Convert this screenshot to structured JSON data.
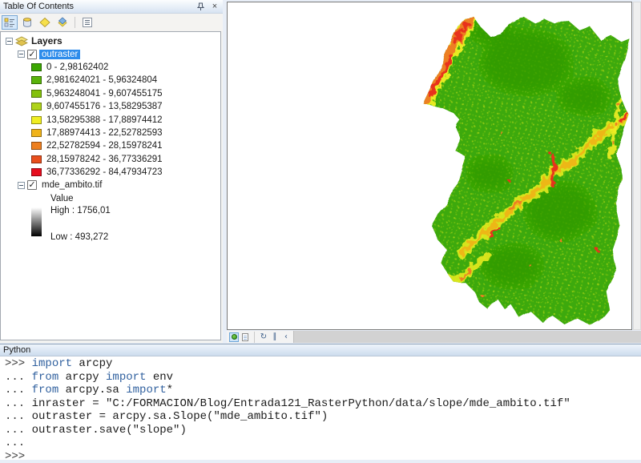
{
  "palette": {
    "selection-blue": "#2D8CEB",
    "keyword-blue": "#31619F",
    "map-green": "#3CA908",
    "map-green-dark": "#2E9902",
    "speckle-green": "#9ED313",
    "speckle-yellow": "#F0EE22",
    "ridge-orange": "#F0B31A",
    "ridge-orange-deep": "#ED7F20",
    "ridge-red": "#E8321C"
  },
  "icons": {
    "close": "×",
    "check": "✓",
    "refresh": "↻",
    "pause": "∥",
    "back": "‹"
  },
  "toc": {
    "title": "Table Of Contents",
    "toolbar": [
      {
        "name": "list-by-drawing-order",
        "selected": true
      },
      {
        "name": "list-by-source",
        "selected": false
      },
      {
        "name": "list-by-visibility",
        "selected": false
      },
      {
        "name": "list-by-selection",
        "selected": false
      },
      {
        "name": "options",
        "selected": false
      }
    ],
    "tree": {
      "root_label": "Layers",
      "outraster": {
        "label": "outraster",
        "checked": true,
        "selected": true,
        "classes": [
          {
            "color": "#3BA602",
            "label": "0 - 2,98162402"
          },
          {
            "color": "#59B30B",
            "label": "2,981624021 - 5,96324804"
          },
          {
            "color": "#83C10C",
            "label": "5,963248041 - 9,607455175"
          },
          {
            "color": "#AFD31A",
            "label": "9,607455176 - 13,58295387"
          },
          {
            "color": "#F0EE22",
            "label": "13,58295388 - 17,88974412"
          },
          {
            "color": "#F0B31A",
            "label": "17,88974413 - 22,52782593"
          },
          {
            "color": "#ED7F20",
            "label": "22,52782594 - 28,15978241"
          },
          {
            "color": "#E94F1D",
            "label": "28,15978242 - 36,77336291"
          },
          {
            "color": "#E60D1E",
            "label": "36,77336292 - 84,47934723"
          }
        ]
      },
      "mde": {
        "label": "mde_ambito.tif",
        "checked": true,
        "value_label": "Value",
        "high": "High : 1756,01",
        "low": "Low : 493,272"
      }
    }
  },
  "map": {
    "statusbar": [
      "data-view",
      "layout-view",
      "refresh",
      "pause",
      "back"
    ]
  },
  "python": {
    "title": "Python",
    "lines": [
      {
        "prompt": ">>> ",
        "tokens": [
          {
            "c": "kw",
            "t": "import"
          },
          {
            "c": "pl",
            "t": " arcpy"
          }
        ]
      },
      {
        "prompt": "... ",
        "tokens": [
          {
            "c": "kw",
            "t": "from"
          },
          {
            "c": "pl",
            "t": " arcpy "
          },
          {
            "c": "kw",
            "t": "import"
          },
          {
            "c": "pl",
            "t": " env"
          }
        ]
      },
      {
        "prompt": "... ",
        "tokens": [
          {
            "c": "kw",
            "t": "from"
          },
          {
            "c": "pl",
            "t": " arcpy.sa "
          },
          {
            "c": "kw",
            "t": "import"
          },
          {
            "c": "pl",
            "t": "*"
          }
        ]
      },
      {
        "prompt": "... ",
        "tokens": [
          {
            "c": "pl",
            "t": "inraster = \"C:/FORMACION/Blog/Entrada121_RasterPython/data/slope/mde_ambito.tif\""
          }
        ]
      },
      {
        "prompt": "... ",
        "tokens": [
          {
            "c": "pl",
            "t": "outraster = arcpy.sa.Slope(\"mde_ambito.tif\")"
          }
        ]
      },
      {
        "prompt": "... ",
        "tokens": [
          {
            "c": "pl",
            "t": "outraster.save(\"slope\")"
          }
        ]
      },
      {
        "prompt": "...",
        "tokens": []
      },
      {
        "prompt": ">>>",
        "tokens": []
      }
    ]
  }
}
